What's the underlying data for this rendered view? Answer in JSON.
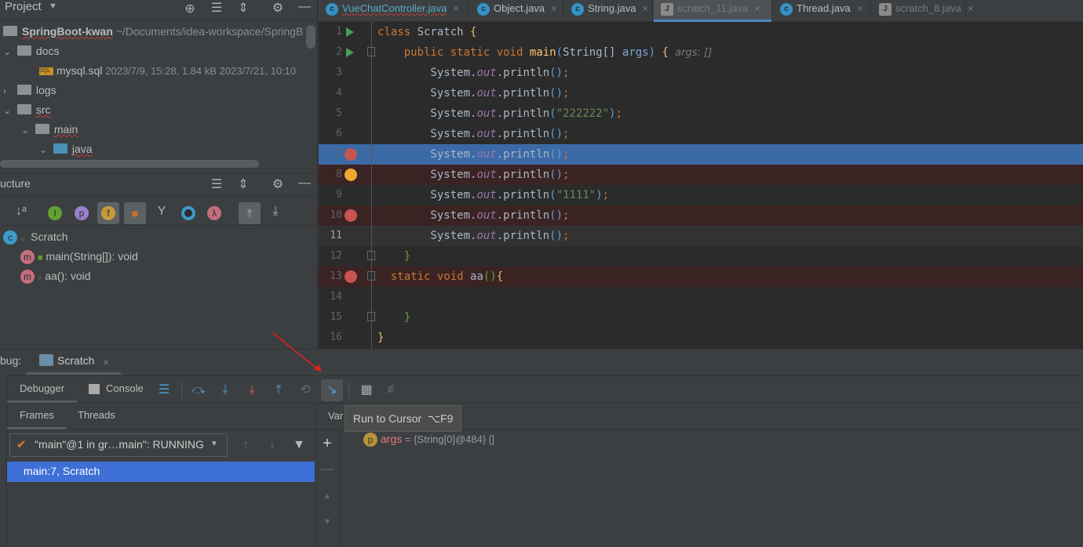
{
  "project": {
    "title": "Project",
    "root_name": "SpringBoot-kwan",
    "root_path": "~/Documents/idea-workspace/SpringB",
    "items": [
      {
        "label": "docs",
        "chev": "⌄"
      },
      {
        "label": "mysql.sql",
        "meta": "2023/7/9, 15:28, 1.84 kB 2023/7/21, 10:10"
      },
      {
        "label": "logs",
        "chev": "›"
      },
      {
        "label": "src",
        "chev": "⌄"
      },
      {
        "label": "main",
        "chev": "⌄"
      },
      {
        "label": "java",
        "chev": "⌄"
      }
    ]
  },
  "structure": {
    "title": "ucture",
    "class_name": "Scratch",
    "members": [
      "main(String[]): void",
      "aa(): void"
    ]
  },
  "tabs": [
    {
      "label": "VueChatController.java"
    },
    {
      "label": "Object.java"
    },
    {
      "label": "String.java"
    },
    {
      "label": "scratch_11.java",
      "active": true
    },
    {
      "label": "Thread.java"
    },
    {
      "label": "scratch_8.java"
    }
  ],
  "code": [
    {
      "n": "1",
      "bg": "",
      "run": true,
      "tokens": [
        [
          "class ",
          "kw"
        ],
        [
          "Scratch ",
          "cls"
        ],
        [
          "{",
          "ybr"
        ]
      ]
    },
    {
      "n": "2",
      "bg": "",
      "run": true,
      "tokens": [
        [
          "    public static void ",
          "kw"
        ],
        [
          "main",
          "fn"
        ],
        [
          "(",
          "par"
        ],
        [
          "String[] ",
          "txt"
        ],
        [
          "args",
          "fld2"
        ],
        [
          ")",
          "par"
        ],
        [
          " {",
          "ybr"
        ],
        [
          "  args: []",
          "hint"
        ]
      ]
    },
    {
      "n": "3",
      "bg": "",
      "tokens": [
        [
          "        System.",
          "txt"
        ],
        [
          "out",
          "fld"
        ],
        [
          ".println",
          "txt"
        ],
        [
          "()",
          "par"
        ],
        [
          ";",
          "semi"
        ]
      ]
    },
    {
      "n": "4",
      "bg": "",
      "tokens": [
        [
          "        System.",
          "txt"
        ],
        [
          "out",
          "fld"
        ],
        [
          ".println",
          "txt"
        ],
        [
          "()",
          "par"
        ],
        [
          ";",
          "semi"
        ]
      ]
    },
    {
      "n": "5",
      "bg": "",
      "tokens": [
        [
          "        System.",
          "txt"
        ],
        [
          "out",
          "fld"
        ],
        [
          ".println",
          "txt"
        ],
        [
          "(",
          "par"
        ],
        [
          "\"222222\"",
          "str"
        ],
        [
          ")",
          "par"
        ],
        [
          ";",
          "semi"
        ]
      ]
    },
    {
      "n": "6",
      "bg": "",
      "tokens": [
        [
          "        System.",
          "txt"
        ],
        [
          "out",
          "fld"
        ],
        [
          ".println",
          "txt"
        ],
        [
          "()",
          "par"
        ],
        [
          ";",
          "semi"
        ]
      ]
    },
    {
      "n": "7",
      "bg": "sel",
      "bp": "#c75450",
      "tokens": [
        [
          "        System.",
          "txt"
        ],
        [
          "out",
          "fld"
        ],
        [
          ".println",
          "txt"
        ],
        [
          "()",
          "par"
        ],
        [
          ";",
          "semi"
        ]
      ]
    },
    {
      "n": "8",
      "bg": "bp",
      "bp": "#f0a732",
      "tokens": [
        [
          "        System.",
          "txt"
        ],
        [
          "out",
          "fld"
        ],
        [
          ".println",
          "txt"
        ],
        [
          "()",
          "par"
        ],
        [
          ";",
          "semi"
        ]
      ]
    },
    {
      "n": "9",
      "bg": "",
      "tokens": [
        [
          "        System.",
          "txt"
        ],
        [
          "out",
          "fld"
        ],
        [
          ".println",
          "txt"
        ],
        [
          "(",
          "par"
        ],
        [
          "\"1111\"",
          "str"
        ],
        [
          ")",
          "par"
        ],
        [
          ";",
          "semi"
        ]
      ]
    },
    {
      "n": "10",
      "bg": "bp",
      "bp": "#c75450",
      "tokens": [
        [
          "        System.",
          "txt"
        ],
        [
          "out",
          "fld"
        ],
        [
          ".println",
          "txt"
        ],
        [
          "()",
          "par"
        ],
        [
          ";",
          "semi"
        ]
      ]
    },
    {
      "n": "11",
      "bg": "cur",
      "tokens": [
        [
          "        System.",
          "txt"
        ],
        [
          "out",
          "fld"
        ],
        [
          ".println",
          "txt"
        ],
        [
          "()",
          "par"
        ],
        [
          ";",
          "semi"
        ]
      ]
    },
    {
      "n": "12",
      "bg": "",
      "tokens": [
        [
          "    }",
          "brc"
        ]
      ]
    },
    {
      "n": "13",
      "bg": "bp",
      "bp": "#c75450",
      "tokens": [
        [
          "  static void ",
          "kw"
        ],
        [
          "aa",
          "txt"
        ],
        [
          "()",
          "brc"
        ],
        [
          "{",
          "ybr"
        ]
      ]
    },
    {
      "n": "14",
      "bg": "",
      "tokens": []
    },
    {
      "n": "15",
      "bg": "",
      "tokens": [
        [
          "    }",
          "brc"
        ]
      ]
    },
    {
      "n": "16",
      "bg": "",
      "tokens": [
        [
          "}",
          "ybr"
        ]
      ]
    }
  ],
  "debug": {
    "label": "bug:",
    "session": "Scratch",
    "tabs": [
      "Debugger",
      "Console"
    ],
    "subtabs": [
      "Frames",
      "Threads"
    ],
    "thread": "\"main\"@1 in gr…main\": RUNNING",
    "frame": "main:7, Scratch",
    "variables_label": "Var",
    "tooltip": "Run to Cursor  ⌥F9",
    "var": {
      "name": "args",
      "value": "= {String[0]@484} []"
    }
  },
  "colors": {
    "accent": "#4a88c7",
    "selection": "#3c6aa6",
    "breakpoint_line": "#3a2323",
    "arrow": "#e02020"
  }
}
